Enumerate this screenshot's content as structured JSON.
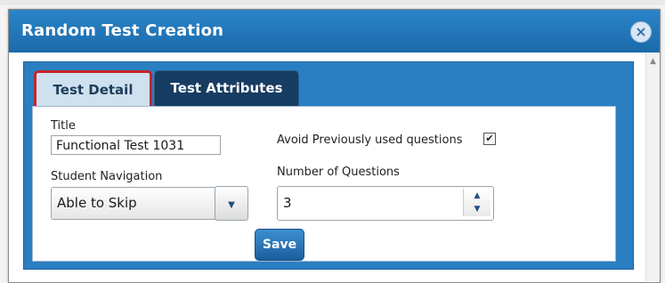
{
  "dialog": {
    "title": "Random Test Creation",
    "close_glyph": "×"
  },
  "tabs": [
    {
      "label": "Test Detail",
      "active": true
    },
    {
      "label": "Test Attributes",
      "active": false
    }
  ],
  "form": {
    "title_label": "Title",
    "title_value": "Functional Test 1031",
    "avoid_label": "Avoid Previously used questions",
    "avoid_checked": true,
    "navigation_label": "Student Navigation",
    "navigation_value": "Able to Skip",
    "num_questions_label": "Number of Questions",
    "num_questions_value": "3",
    "save_label": "Save"
  },
  "colors": {
    "titlebar": "#1f73b7",
    "panel": "#2a7fc3",
    "active_tab_highlight": "#c8242b",
    "inactive_tab": "#173c62"
  },
  "icons": {
    "close": "close-icon",
    "dropdown": "chevron-down-icon",
    "spin_up": "spin-up-icon",
    "spin_down": "spin-down-icon",
    "checkbox": "checkmark-icon"
  }
}
